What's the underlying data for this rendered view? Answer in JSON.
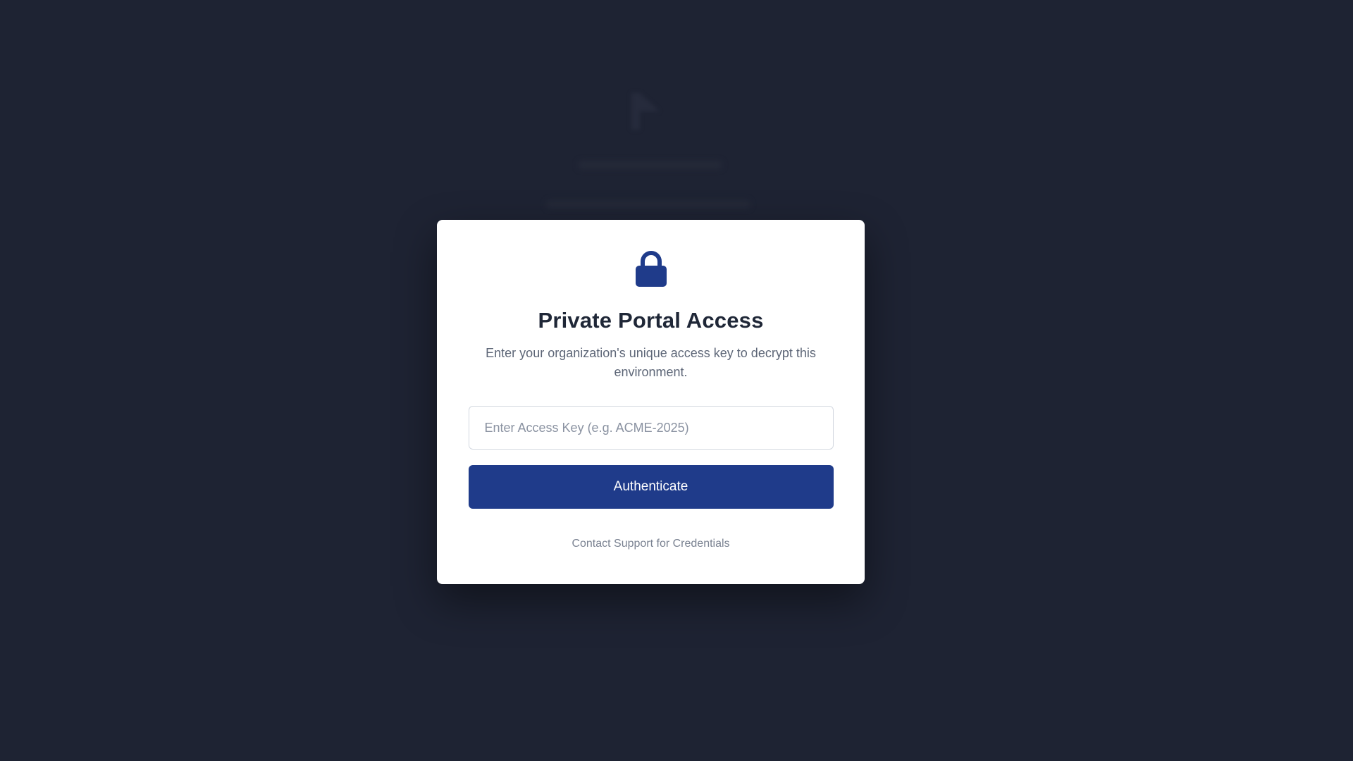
{
  "modal": {
    "title": "Private Portal Access",
    "subtitle": "Enter your organization's unique access key to decrypt this environment.",
    "access_key": {
      "value": "",
      "placeholder": "Enter Access Key (e.g. ACME-2025)"
    },
    "authenticate_label": "Authenticate",
    "support_link_label": "Contact Support for Credentials",
    "icon": "lock-icon"
  },
  "colors": {
    "background": "#1e2333",
    "modal_background": "#ffffff",
    "accent": "#1f3b8a",
    "title_text": "#1f2737",
    "muted_text": "#5d6677"
  }
}
